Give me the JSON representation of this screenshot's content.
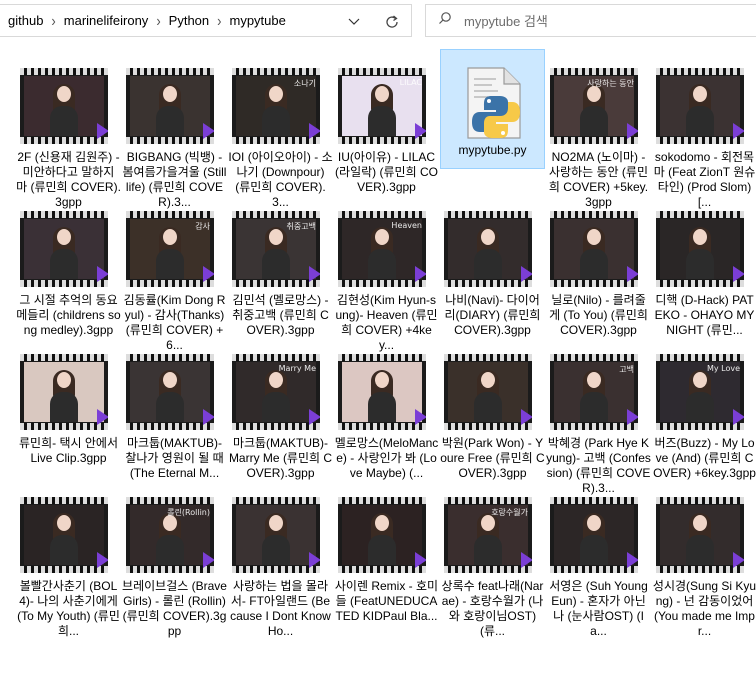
{
  "address": {
    "crumbs": [
      "github",
      "marinelifeirony",
      "Python",
      "mypytube"
    ]
  },
  "search": {
    "placeholder": "mypytube 검색"
  },
  "accent_colors": {
    "play_overlay": "#7b3ed6",
    "selection": "#cce8ff"
  },
  "files": [
    {
      "label": "2F (신용재 김원주) - 미안하다고 말하지 마 (류민희 COVER).3gpp",
      "caption": "",
      "tint": "#3b2b2f"
    },
    {
      "label": "BIGBANG (빅뱅) - 봄여름가을겨울 (Still life) (류민희 COVER).3...",
      "caption": "",
      "tint": "#3a3330"
    },
    {
      "label": "IOI (아이오아이) - 소나기 (Downpour) (류민희 COVER).3...",
      "caption": "소나기",
      "tint": "#2f2a26"
    },
    {
      "label": "IU(아이유) - LILAC(라일락) (류민희 COVER).3gpp",
      "caption": "LILAC",
      "tint": "#e8e0ef"
    },
    {
      "label": "mypytube.py",
      "type": "python"
    },
    {
      "label": "NO2MA (노이마) - 사랑하는 동안 (류민희 COVER) +5key.3gpp",
      "caption": "사랑하는 동안",
      "tint": "#4a3b3a"
    },
    {
      "label": "sokodomo - 회전목마 (Feat ZionT 원슈타인) (Prod Slom) [...",
      "caption": "",
      "tint": "#3b3232"
    },
    {
      "label": "그 시절 추억의 동요메들리 (childrens song medley).3gpp",
      "caption": "",
      "tint": "#3a3036"
    },
    {
      "label": "김동률(Kim Dong Ryul) - 감사(Thanks) (류민희 COVER) +6...",
      "caption": "감사",
      "tint": "#3c3028"
    },
    {
      "label": "김민석 (멜로망스) - 취중고백 (류민희 COVER).3gpp",
      "caption": "취중고백",
      "tint": "#3a3434"
    },
    {
      "label": "김현성(Kim Hyun-sung)- Heaven (류민희 COVER) +4key...",
      "caption": "Heaven",
      "tint": "#2e2727"
    },
    {
      "label": "나비(Navi)- 다이어리(DIARY) (류민희 COVER).3gpp",
      "caption": "",
      "tint": "#332c2c"
    },
    {
      "label": "닐로(Nilo) - 를려줄게 (To You) (류민희 COVER).3gpp",
      "caption": "",
      "tint": "#3a3030"
    },
    {
      "label": "디핵 (D-Hack) PATEKO - OHAYO MY NIGHT (류민...",
      "caption": "",
      "tint": "#2a2626"
    },
    {
      "label": "류민희- 택시 안에서 Live Clip.3gpp",
      "caption": "",
      "tint": "#d9c8c0"
    },
    {
      "label": "마크툽(MAKTUB)- 찰나가 영원이 될 때 (The Eternal M...",
      "caption": "",
      "tint": "#3a3434"
    },
    {
      "label": "마크툽(MAKTUB)- Marry Me (류민희 COVER).3gpp",
      "caption": "Marry Me",
      "tint": "#302a2a"
    },
    {
      "label": "멜로망스(MeloMance) - 사랑인가 봐 (Love Maybe) (...",
      "caption": "",
      "tint": "#dcc7c2"
    },
    {
      "label": "박원(Park Won) - Youre Free (류민희 COVER).3gpp",
      "caption": "",
      "tint": "#3a302a"
    },
    {
      "label": "박혜경 (Park Hye Kyung)- 고백 (Confession) (류민희 COVER).3...",
      "caption": "고백",
      "tint": "#3a3030"
    },
    {
      "label": "버즈(Buzz) - My Love (And) (류민희 COVER) +6key.3gpp",
      "caption": "My Love",
      "tint": "#2e2a30"
    },
    {
      "label": "볼빨간사춘기 (BOL4)- 나의 사춘기에게 (To My Youth) (류민희...",
      "caption": "",
      "tint": "#2a2424"
    },
    {
      "label": "브레이브걸스 (Brave Girls) - 롤린 (Rollin) (류민희 COVER).3gpp",
      "caption": "롤린(Rollin)",
      "tint": "#332a2a"
    },
    {
      "label": "사랑하는 법을 몰라서- FT아일랜드 (Because I Dont Know Ho...",
      "caption": "",
      "tint": "#3a3232"
    },
    {
      "label": "사이렌 Remix - 호미들 (FeatUNEDUCATED KIDPaul Bla...",
      "caption": "",
      "tint": "#2c2222"
    },
    {
      "label": "상록수 feat나래(Narae) - 호랑수월가 (나와 호랑이님OST) (류...",
      "caption": "호랑수월가",
      "tint": "#3a2e2e"
    },
    {
      "label": "서영은 (Suh Young Eun) - 혼자가 아닌 나 (눈사람OST) (I a...",
      "caption": "",
      "tint": "#2c2626"
    },
    {
      "label": "성시경(Sung Si Kyung) - 넌 감동이었어(You made me Impr...",
      "caption": "",
      "tint": "#332c2c"
    }
  ]
}
